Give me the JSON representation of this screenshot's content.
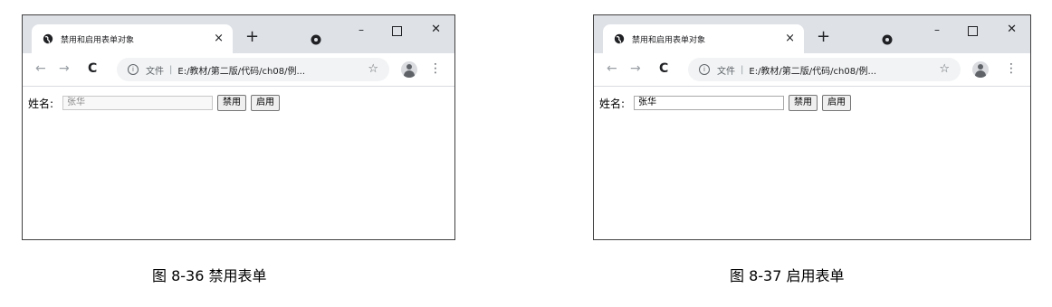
{
  "figures": [
    {
      "tab_title": "禁用和启用表单对象",
      "tab_close": "×",
      "new_tab": "+",
      "window_minimize": "–",
      "window_close": "✕",
      "nav_back": "←",
      "nav_forward": "→",
      "nav_reload": "C",
      "info_glyph": "i",
      "file_label": "文件",
      "separator": "|",
      "url": "E:/教材/第二版/代码/ch08/例...",
      "star": "☆",
      "menu": "⋮",
      "name_label": "姓名:",
      "name_value": "张华",
      "name_state": "disabled",
      "disable_button": "禁用",
      "enable_button": "启用",
      "caption": "图 8-36  禁用表单"
    },
    {
      "tab_title": "禁用和启用表单对象",
      "tab_close": "×",
      "new_tab": "+",
      "window_minimize": "–",
      "window_close": "✕",
      "nav_back": "←",
      "nav_forward": "→",
      "nav_reload": "C",
      "info_glyph": "i",
      "file_label": "文件",
      "separator": "|",
      "url": "E:/教材/第二版/代码/ch08/例...",
      "star": "☆",
      "menu": "⋮",
      "name_label": "姓名:",
      "name_value": "张华",
      "name_state": "enabled",
      "disable_button": "禁用",
      "enable_button": "启用",
      "caption": "图 8-37  启用表单"
    }
  ],
  "colors": {
    "titlebar": "#dee1e6",
    "omnibox": "#f1f3f4",
    "disabled_text": "#8a8a8a"
  }
}
